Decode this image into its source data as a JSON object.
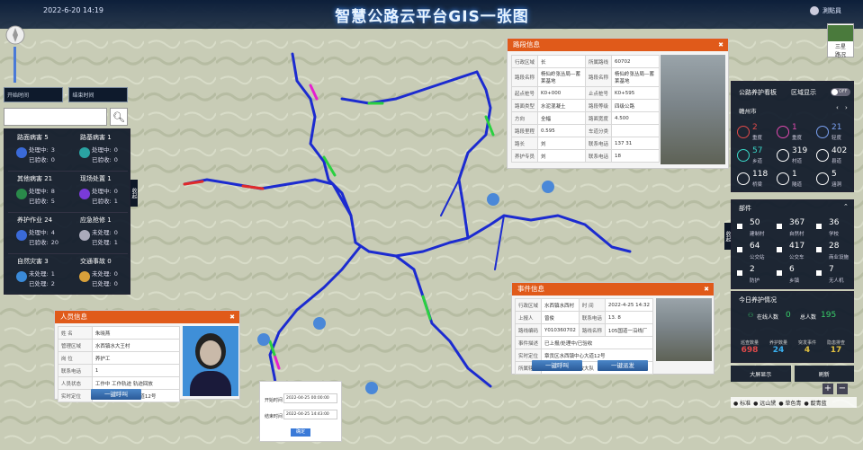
{
  "header": {
    "datetime": "2022-6-20 14:19",
    "title": "智慧公路云平台GIS一张图",
    "user": "測點員"
  },
  "left_panel": {
    "date_start_placeholder": "开始时间",
    "date_end_placeholder": "结束时间",
    "cells": [
      {
        "title": "路面病害 5",
        "l1k": "处理中:",
        "l1v": "3",
        "l2k": "已验收:",
        "l2v": "0",
        "color": "#3a6ad8"
      },
      {
        "title": "路基病害 1",
        "l1k": "处理中:",
        "l1v": "0",
        "l2k": "已验收:",
        "l2v": "0",
        "color": "#2aa3a3"
      },
      {
        "title": "其他病害 21",
        "l1k": "处理中:",
        "l1v": "8",
        "l2k": "已验收:",
        "l2v": "5",
        "color": "#2a8a4a"
      },
      {
        "title": "现场处置 1",
        "l1k": "处理中:",
        "l1v": "0",
        "l2k": "已验收:",
        "l2v": "1",
        "color": "#7a3ad8"
      },
      {
        "title": "养护作业 24",
        "l1k": "处理中:",
        "l1v": "4",
        "l2k": "已验收:",
        "l2v": "20",
        "color": "#3a6ad8"
      },
      {
        "title": "应急抢修 1",
        "l1k": "未处理:",
        "l1v": "0",
        "l2k": "已处理:",
        "l2v": "1",
        "color": "#aab"
      },
      {
        "title": "自然灾害 3",
        "l1k": "未处理:",
        "l1v": "1",
        "l2k": "已处理:",
        "l2v": "2",
        "color": "#3a8ad8"
      },
      {
        "title": "交通事故 0",
        "l1k": "未处理:",
        "l1v": "0",
        "l2k": "已处理:",
        "l2v": "0",
        "color": "#d8a03a"
      }
    ],
    "collapse": "收起"
  },
  "road_info": {
    "title": "路段信息",
    "rows": [
      [
        "行政区域",
        "长",
        "所属路线",
        "60702"
      ],
      [
        "路段名称",
        "杨仙岭张丛局—蓄莱基地",
        "路段名称",
        "杨仙岭张丛局—蓄莱基地"
      ],
      [
        "起点桩号",
        "K0+000",
        "止点桩号",
        "K0+595"
      ],
      [
        "路面类型",
        "水泥混凝土",
        "路段等级",
        "四级公路"
      ],
      [
        "方向",
        "全幅",
        "路面宽度",
        "4.500"
      ],
      [
        "路段里程",
        "0.595",
        "车道分类",
        ""
      ],
      [
        "路长",
        "刘",
        "联系电话",
        "137 31"
      ],
      [
        "养护专员",
        "刘",
        "联系电话",
        "18"
      ]
    ]
  },
  "event_info": {
    "title": "事件信息",
    "rows": [
      [
        "行政区域",
        "水西镇水西村",
        "时 间",
        "2022-4-25 14:32"
      ],
      [
        "上报人",
        "曾俊",
        "联系电话",
        "13.  8"
      ],
      [
        "路线编码",
        "Y010360702",
        "路线名称",
        "105国道一沿线厂"
      ],
      [
        "事件描述",
        "已上报/处理中/已验收"
      ],
      [
        "实时定位",
        "章贡区水西镇中心大道12号"
      ],
      [
        "所属辖区",
        "章贡区水西镇路政大队"
      ]
    ],
    "call": "一键呼叫",
    "dispatch": "一键派发"
  },
  "person_info": {
    "title": "人员信息",
    "rows": [
      [
        "姓 名",
        "朱晓燕"
      ],
      [
        "管理区域",
        "水西镇水大王村"
      ],
      [
        "岗 位",
        "养护工"
      ],
      [
        "联系电话",
        "1"
      ],
      [
        "人员状态",
        "工作中  工作轨迹  轨迹回放"
      ],
      [
        "实时定位",
        "章贡区水西镇中心大道12号"
      ]
    ],
    "call": "一键呼叫"
  },
  "time_dialog": {
    "start_label": "开始时间",
    "start_value": "2022-04-25 00:00:00",
    "end_label": "结束时间",
    "end_value": "2022-04-25 14:43:00",
    "ok": "确定"
  },
  "right_panel": {
    "header1": "公路养护看板",
    "header2": "区域显示",
    "toggle": "OFF",
    "city": "赣州市",
    "collapse": "收起",
    "stats": [
      {
        "v": "2",
        "t": "重度",
        "c": "#e04a4a"
      },
      {
        "v": "1",
        "t": "重度",
        "c": "#e04ab0"
      },
      {
        "v": "21",
        "t": "轻度",
        "c": "#7aa0f0"
      },
      {
        "v": "57",
        "t": "乡道",
        "c": "#3ad8c8"
      },
      {
        "v": "319",
        "t": "村道",
        "c": "#ffffff"
      },
      {
        "v": "402",
        "t": "县道",
        "c": "#ffffff"
      },
      {
        "v": "118",
        "t": "桥梁",
        "c": "#ffffff"
      },
      {
        "v": "1",
        "t": "隧道",
        "c": "#ffffff"
      },
      {
        "v": "5",
        "t": "涵洞",
        "c": "#ffffff"
      }
    ],
    "parts_title": "部件",
    "parts": [
      {
        "v": "50",
        "t": "建制村"
      },
      {
        "v": "367",
        "t": "自然村"
      },
      {
        "v": "36",
        "t": "学校"
      },
      {
        "v": "64",
        "t": "公交站"
      },
      {
        "v": "417",
        "t": "公交车"
      },
      {
        "v": "28",
        "t": "商业设施"
      },
      {
        "v": "2",
        "t": "防护"
      },
      {
        "v": "6",
        "t": "乡镇"
      },
      {
        "v": "7",
        "t": "无人机"
      }
    ],
    "today_title": "今日养护情况",
    "online_label": "在线人数",
    "online": "0",
    "total_label": "总人数",
    "total": "195",
    "metrics": [
      {
        "v": "698",
        "t": "巡查数量",
        "c": "#e04a4a"
      },
      {
        "v": "24",
        "t": "养护数量",
        "c": "#3ab0f0"
      },
      {
        "v": "4",
        "t": "突发事件",
        "c": "#e0c040"
      },
      {
        "v": "17",
        "t": "隐患排查",
        "c": "#e0c040"
      }
    ],
    "big_screen": "大屏显示",
    "refresh": "刷新"
  },
  "map_controls": {
    "type_label": "三星",
    "type_sub": "路况",
    "legend": [
      "标准",
      "远山黛",
      "草色青",
      "靛青蓝"
    ]
  }
}
